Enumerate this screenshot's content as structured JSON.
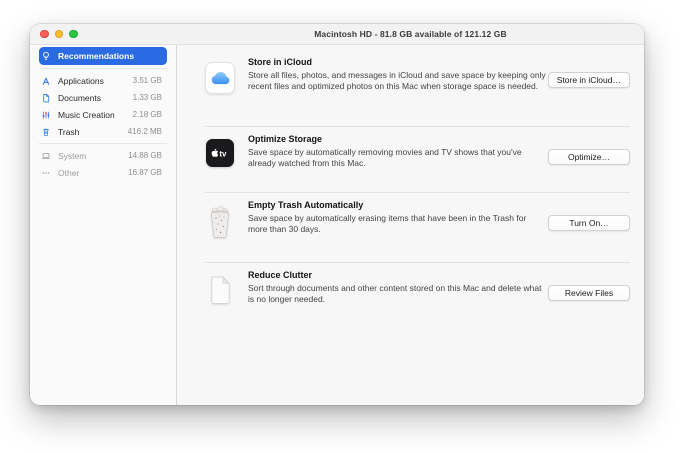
{
  "window": {
    "title": "Macintosh HD - 81.8 GB available of 121.12 GB"
  },
  "sidebar": {
    "items": [
      {
        "label": "Recommendations",
        "value": "",
        "icon": "lightbulb-icon",
        "selected": true
      },
      {
        "label": "Applications",
        "value": "3.51 GB",
        "icon": "app-store-a-icon"
      },
      {
        "label": "Documents",
        "value": "1.33 GB",
        "icon": "document-icon"
      },
      {
        "label": "Music Creation",
        "value": "2.18 GB",
        "icon": "sliders-icon"
      },
      {
        "label": "Trash",
        "value": "416.2 MB",
        "icon": "trash-icon"
      },
      {
        "label": "System",
        "value": "14.88 GB",
        "icon": "laptop-icon",
        "dimmed": true
      },
      {
        "label": "Other",
        "value": "16.87 GB",
        "icon": "ellipsis-icon",
        "dimmed": true
      }
    ]
  },
  "recommendations": [
    {
      "title": "Store in iCloud",
      "description": "Store all files, photos, and messages in iCloud and save space by keeping only recent files and optimized photos on this Mac when storage space is needed.",
      "button": "Store in iCloud…",
      "icon": "icloud-icon"
    },
    {
      "title": "Optimize Storage",
      "description": "Save space by automatically removing movies and TV shows that you've already watched from this Mac.",
      "button": "Optimize…",
      "icon": "apple-tv-icon"
    },
    {
      "title": "Empty Trash Automatically",
      "description": "Save space by automatically erasing items that have been in the Trash for more than 30 days.",
      "button": "Turn On…",
      "icon": "trash-full-icon"
    },
    {
      "title": "Reduce Clutter",
      "description": "Sort through documents and other content stored on this Mac and delete what is no longer needed.",
      "button": "Review Files",
      "icon": "document-blank-icon"
    }
  ],
  "colors": {
    "accent_blue": "#2a6ae3",
    "sidebar_icon_blue": "#2f7ef3",
    "traffic_red": "#ff5f57",
    "traffic_yellow": "#febc2e",
    "traffic_green": "#28c840",
    "window_bg": "#f8f7f7"
  }
}
